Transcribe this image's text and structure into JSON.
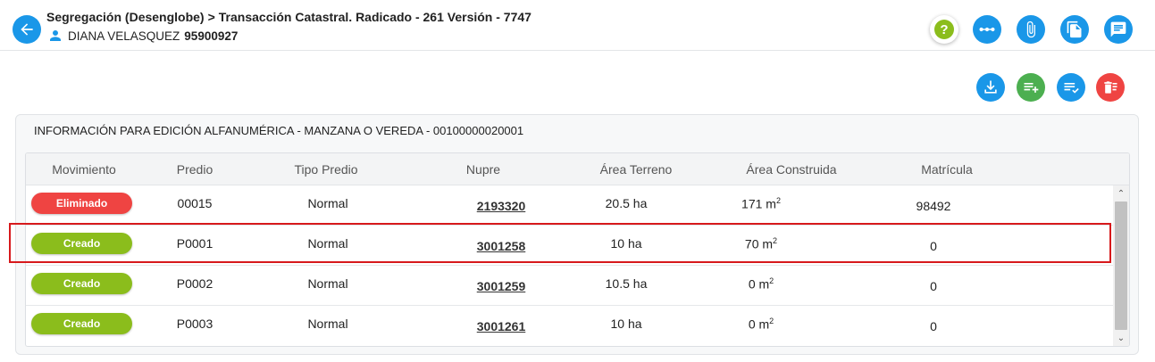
{
  "header": {
    "process": "Segregación (Desenglobe)",
    "separator": ">",
    "transaction": "Transacción Catastral. Radicado - 261 Versión - 7747",
    "user_name": "DIANA VELASQUEZ",
    "user_id": "95900927"
  },
  "header_icons": [
    "help-icon",
    "workflow-icon",
    "attachment-icon",
    "documents-icon",
    "notes-icon"
  ],
  "help_glyph": "?",
  "action_icons": [
    "download-icon",
    "add-list-icon",
    "check-list-icon",
    "delete-list-icon"
  ],
  "colors": {
    "primary_blue": "#1a97e8",
    "green": "#4caf50",
    "red": "#ef4442",
    "lime": "#8bbd1c",
    "highlight": "#d7191c"
  },
  "panel": {
    "title": "INFORMACIÓN PARA EDICIÓN ALFANUMÉRICA - MANZANA O VEREDA - 0010000002000​1"
  },
  "table": {
    "columns": [
      "Movimiento",
      "Predio",
      "Tipo Predio",
      "Nupre",
      "Área Terreno",
      "Área Construida",
      "Matrícula"
    ],
    "unit_sup": "2",
    "rows": [
      {
        "movimiento": "Eliminado",
        "predio": "00015",
        "tipo": "Normal",
        "nupre": "2193320",
        "area_terreno": "20.5 ha",
        "area_construida": "171 m",
        "matricula": "98492"
      },
      {
        "movimiento": "Creado",
        "predio": "P0001",
        "tipo": "Normal",
        "nupre": "3001258",
        "area_terreno": "10 ha",
        "area_construida": "70 m",
        "matricula": "0"
      },
      {
        "movimiento": "Creado",
        "predio": "P0002",
        "tipo": "Normal",
        "nupre": "3001259",
        "area_terreno": "10.5 ha",
        "area_construida": "0 m",
        "matricula": "0"
      },
      {
        "movimiento": "Creado",
        "predio": "P0003",
        "tipo": "Normal",
        "nupre": "3001261",
        "area_terreno": "10 ha",
        "area_construida": "0 m",
        "matricula": "0"
      }
    ]
  },
  "scrollbar": {
    "up": "⌃",
    "down": "⌄"
  }
}
